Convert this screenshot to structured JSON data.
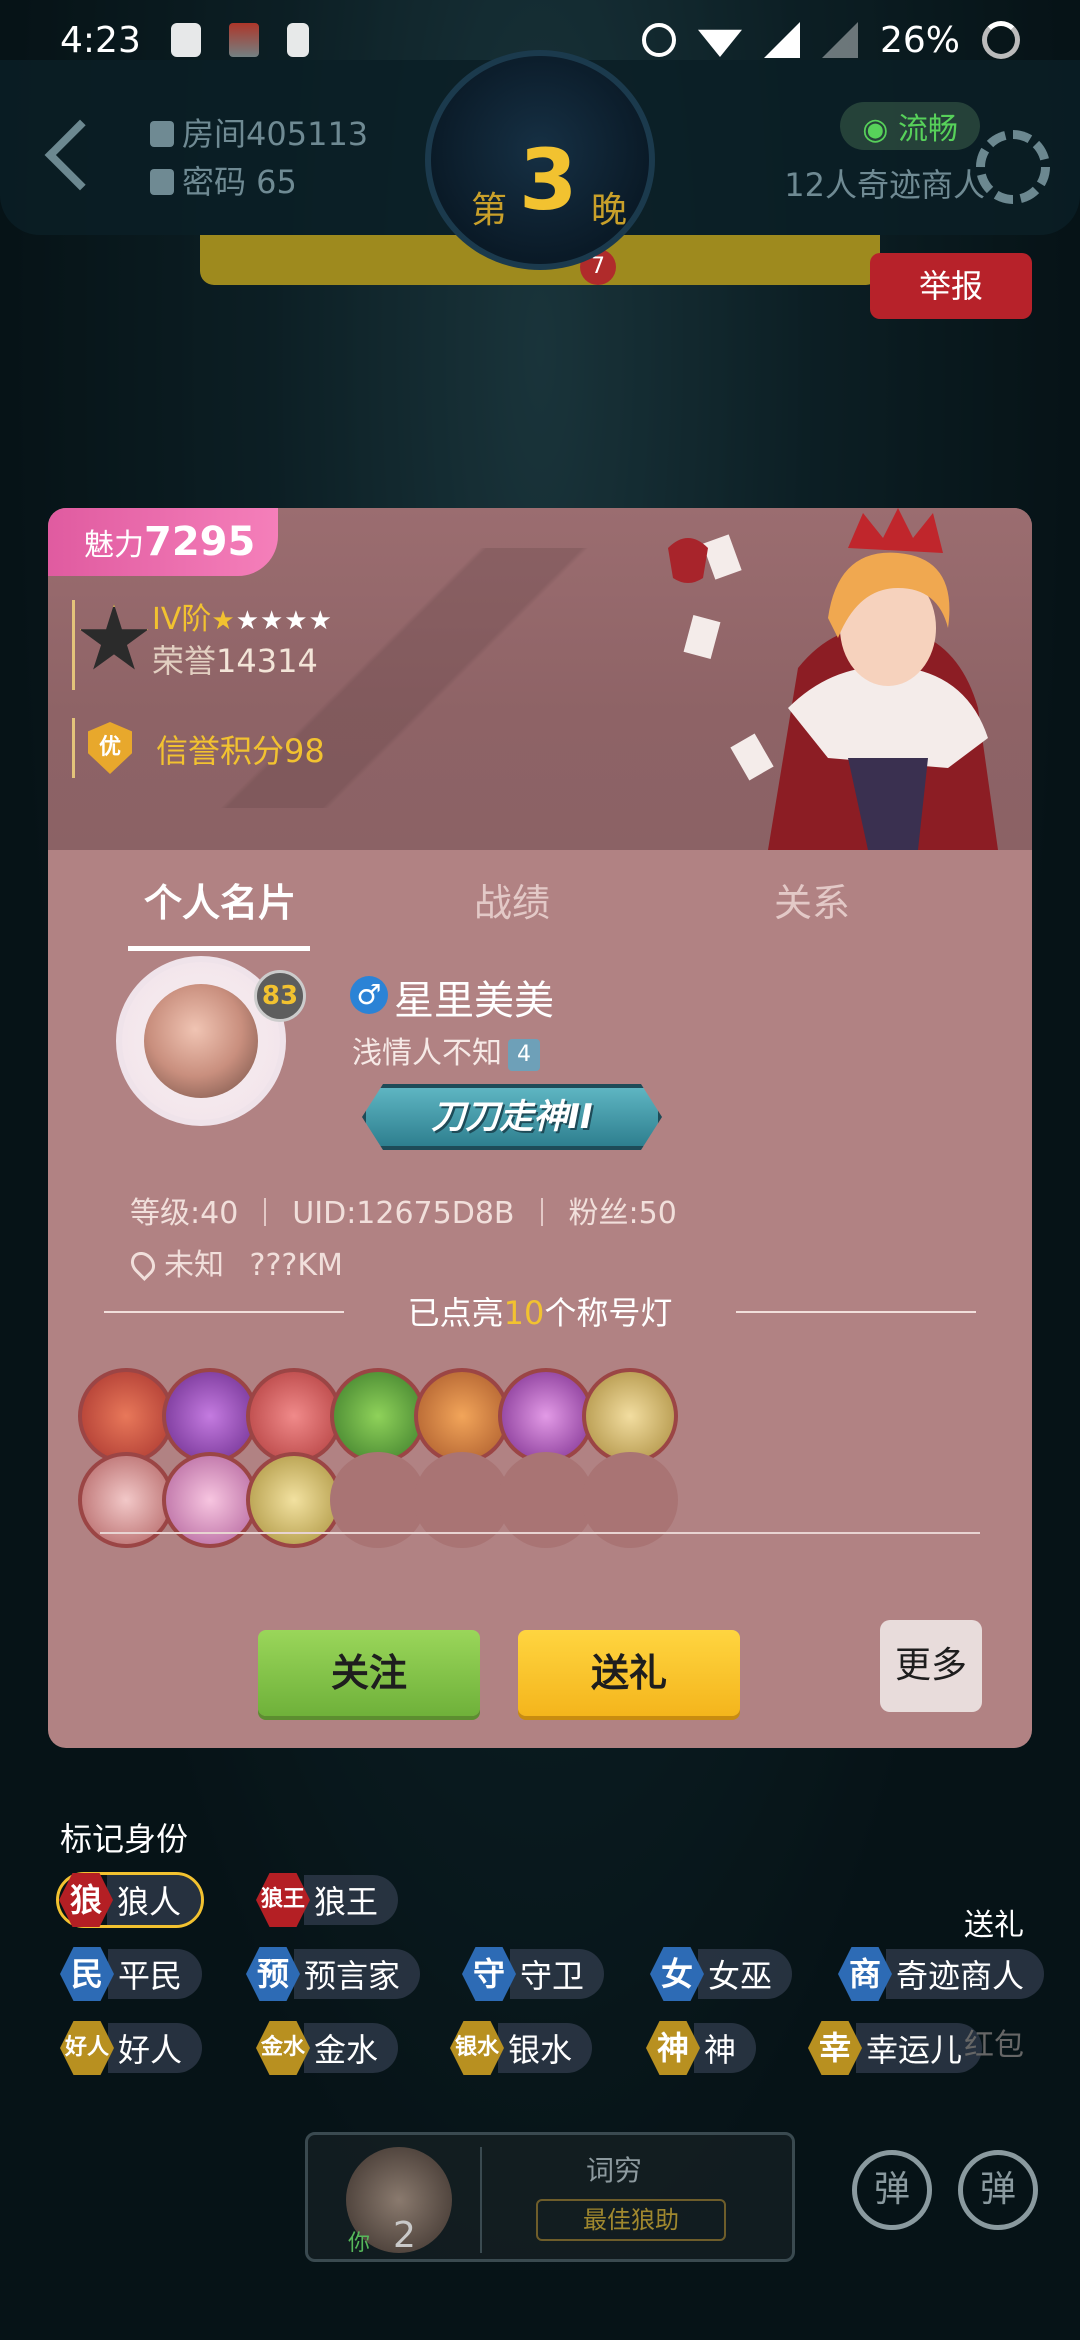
{
  "status_bar": {
    "time": "4:23",
    "battery": "26%"
  },
  "room": {
    "room_label": "房间405113",
    "password_label": "密码 65",
    "night_prefix": "第",
    "night_number": "3",
    "night_suffix": "晚",
    "network": "流畅",
    "mode": "12人奇迹商人",
    "counter": "7",
    "report_label": "举报"
  },
  "card": {
    "charm_label": "魅力",
    "charm_value": "7295",
    "rank_label": "IV阶",
    "rank_stars_gold": "★",
    "rank_stars_white": "★★★★",
    "honor_label": "荣誉",
    "honor_value": "14314",
    "credit_badge": "优",
    "credit_text": "信誉积分98",
    "tabs": [
      "个人名片",
      "战绩",
      "关系"
    ],
    "profile": {
      "level": "83",
      "gender_symbol": "♂",
      "nickname": "星里美美",
      "subtitle": "浅情人不知",
      "subtitle_level": "4",
      "title_badge": "刀刀走神II",
      "level_stat": "等级:40",
      "uid_stat": "UID:12675D8B",
      "fans_stat": "粉丝:50",
      "location": "未知",
      "distance": "???KM"
    },
    "lights": {
      "prefix": "已点亮",
      "count": "10",
      "suffix": "个称号灯",
      "lit_total": 10,
      "slots": 14
    },
    "buttons": {
      "follow": "关注",
      "gift": "送礼",
      "more": "更多"
    }
  },
  "roles": {
    "title": "标记身份",
    "items": [
      {
        "tag": "狼",
        "name": "狼人"
      },
      {
        "tag": "狼王",
        "name": "狼王"
      },
      {
        "tag": "民",
        "name": "平民"
      },
      {
        "tag": "预",
        "name": "预言家"
      },
      {
        "tag": "守",
        "name": "守卫"
      },
      {
        "tag": "女",
        "name": "女巫"
      },
      {
        "tag": "商",
        "name": "奇迹商人"
      },
      {
        "tag": "好人",
        "name": "好人"
      },
      {
        "tag": "金水",
        "name": "金水"
      },
      {
        "tag": "银水",
        "name": "银水"
      },
      {
        "tag": "神",
        "name": "神"
      },
      {
        "tag": "幸",
        "name": "幸运儿"
      }
    ]
  },
  "side": {
    "gift": "送礼",
    "red_packet": "红包"
  },
  "bottom": {
    "seat_num": "2",
    "you": "你",
    "username": "词穷",
    "helper_badge": "最佳狼助",
    "danmu_label": "弹"
  },
  "colors": {
    "card_bg": "#b18283",
    "charm_pink": "#e05ba0",
    "gold": "#f2c230",
    "report_red": "#b7222a",
    "follow_green": "#8cc84b",
    "gift_yellow": "#f9c82b"
  }
}
